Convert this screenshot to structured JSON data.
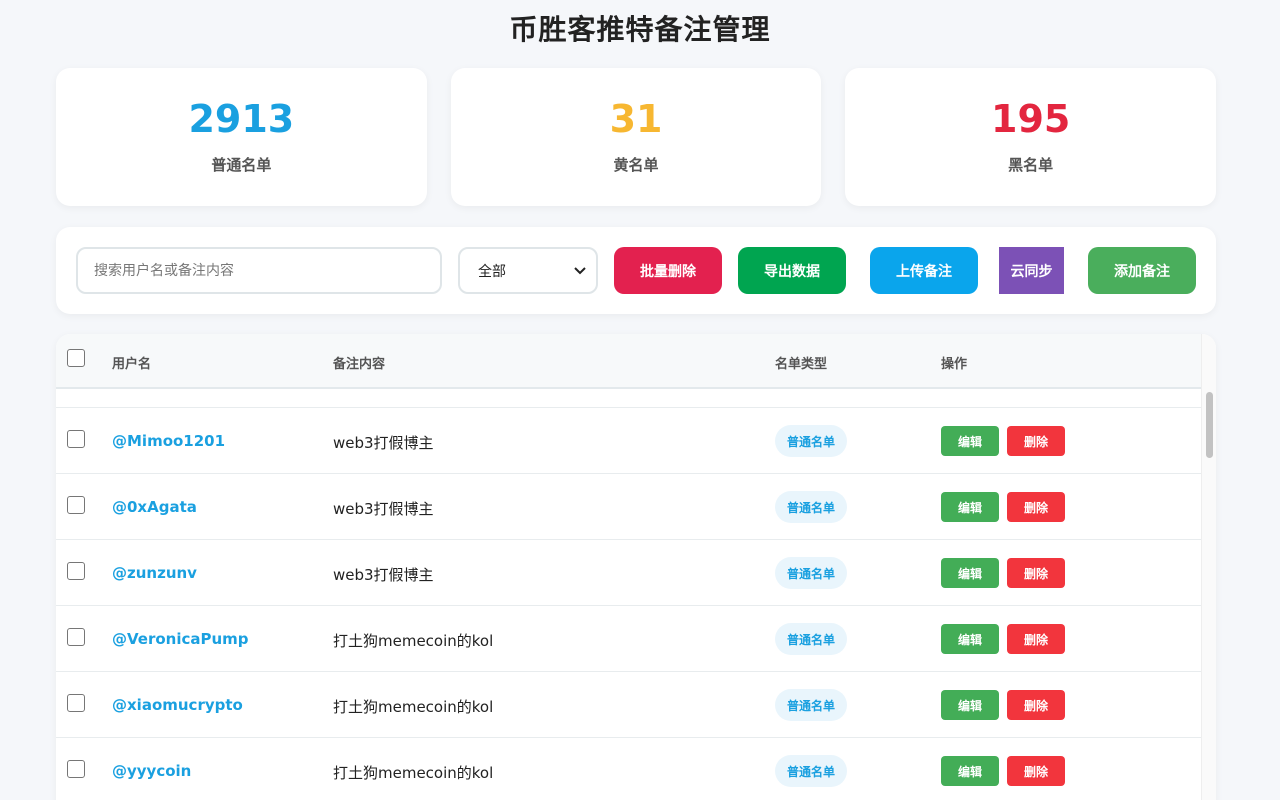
{
  "header": {
    "title": "币胜客推特备注管理"
  },
  "stats": [
    {
      "value": "2913",
      "label": "普通名单",
      "color": "#1aa0e0"
    },
    {
      "value": "31",
      "label": "黄名单",
      "color": "#f7b731"
    },
    {
      "value": "195",
      "label": "黑名单",
      "color": "#e3263f"
    }
  ],
  "toolbar": {
    "search_placeholder": "搜索用户名或备注内容",
    "filter_selected": "全部",
    "batch_delete_label": "批量删除",
    "export_label": "导出数据",
    "upload_label": "上传备注",
    "cloud_sync_label": "云同步",
    "add_label": "添加备注",
    "colors": {
      "batch_delete": "#e3214f",
      "export": "#00a550",
      "upload": "#0aa5ec",
      "cloud_sync": "#7c51b6",
      "add": "#4aae5c"
    }
  },
  "table": {
    "columns": [
      "用户名",
      "备注内容",
      "名单类型",
      "操作"
    ],
    "edit_label": "编辑",
    "delete_label": "删除",
    "rows": [
      {
        "username": "@Mimoo1201",
        "note": "web3打假博主",
        "type": "普通名单"
      },
      {
        "username": "@0xAgata",
        "note": "web3打假博主",
        "type": "普通名单"
      },
      {
        "username": "@zunzunv",
        "note": "web3打假博主",
        "type": "普通名单"
      },
      {
        "username": "@VeronicaPump",
        "note": "打土狗memecoin的kol",
        "type": "普通名单"
      },
      {
        "username": "@xiaomucrypto",
        "note": "打土狗memecoin的kol",
        "type": "普通名单"
      },
      {
        "username": "@yyycoin",
        "note": "打土狗memecoin的kol",
        "type": "普通名单"
      }
    ]
  }
}
